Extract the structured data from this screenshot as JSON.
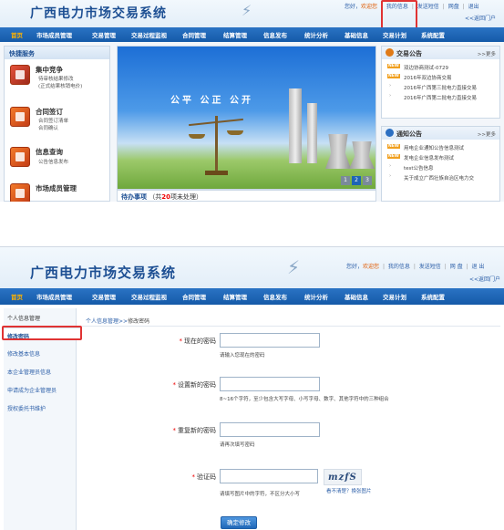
{
  "app": {
    "title": "广西电力市场交易系统"
  },
  "header1": {
    "links": [
      "您好，",
      "",
      "我的信息",
      "发送短信",
      "网盘",
      "退出"
    ],
    "back": "<<返回门户"
  },
  "header2": {
    "greeting": "您好，",
    "user": "欢迎您",
    "links": [
      "我的信息",
      "发送短信",
      "网 盘",
      "退 出"
    ],
    "back": "<<返回门户"
  },
  "nav": {
    "items": [
      "首页",
      "市场成员管理",
      "交易管理",
      "交易过程监视",
      "合同管理",
      "结算管理",
      "信息发布",
      "统计分析",
      "基础信息",
      "交易计划",
      "系统配置"
    ]
  },
  "quick_services": {
    "title": "快捷服务",
    "items": [
      {
        "name": "集中竞争",
        "subs": [
          "待审核结果修改",
          "(正式结果核销电价)"
        ]
      },
      {
        "name": "合同签订",
        "subs": [
          "合同签订清单",
          "合同确认"
        ]
      },
      {
        "name": "信息查询",
        "subs": [
          "公告信息发布"
        ]
      },
      {
        "name": "市场成员管理",
        "subs": []
      }
    ]
  },
  "banner": {
    "slogan": "公平 公正 公开",
    "pages": [
      "1",
      "2",
      "3"
    ]
  },
  "todo": {
    "label": "待办事项",
    "prefix": "（共",
    "count": "20",
    "suffix": "项未处理）"
  },
  "trade_notices": {
    "title": "交易公告",
    "more": ">>更多",
    "items": [
      {
        "new": true,
        "text": "双边协商测试-0729"
      },
      {
        "new": true,
        "text": "2016年双边协商交易"
      },
      {
        "new": false,
        "text": "2016年广西第三批电力直接交易"
      },
      {
        "new": false,
        "text": "2016年广西第二批电力直接交易"
      }
    ]
  },
  "notifications": {
    "title": "通知公告",
    "more": ">>更多",
    "items": [
      {
        "new": true,
        "text": "用电企业通知公告信息测试"
      },
      {
        "new": true,
        "text": "发电企业信息发布测试"
      },
      {
        "new": false,
        "text": "test公告信息"
      },
      {
        "new": false,
        "text": "关于成立广西壮族自治区电力交"
      }
    ]
  },
  "badge_text": "NEW",
  "sidebar": {
    "items": [
      "个人信息管理",
      "修改密码",
      "修改基本信息",
      "本企业管理员信息",
      "申请成为企业管理员",
      "授权委托书维护"
    ]
  },
  "breadcrumb": {
    "parent": "个人信息管理",
    "sep": ">>",
    "current": "修改密码"
  },
  "form": {
    "fields": [
      {
        "label": "现在的密码",
        "hint": "请输入您现在的密码"
      },
      {
        "label": "设置新的密码",
        "hint": "8~16个字符，至少包含大写字母、小写字母、数字、其他字符中的三种组合"
      },
      {
        "label": "重复新的密码",
        "hint": "请再次填写密码"
      },
      {
        "label": "验证码",
        "hint": "请填写图片中的字符，不区分大小写"
      }
    ],
    "captcha_text": "mzfS",
    "captcha_link": "看不清楚？换张图片",
    "submit": "确定修改"
  },
  "colors": {
    "nav": "#1e64b5",
    "highlight": "#e03333",
    "required": "#e00000",
    "link": "#2b5ea8"
  }
}
